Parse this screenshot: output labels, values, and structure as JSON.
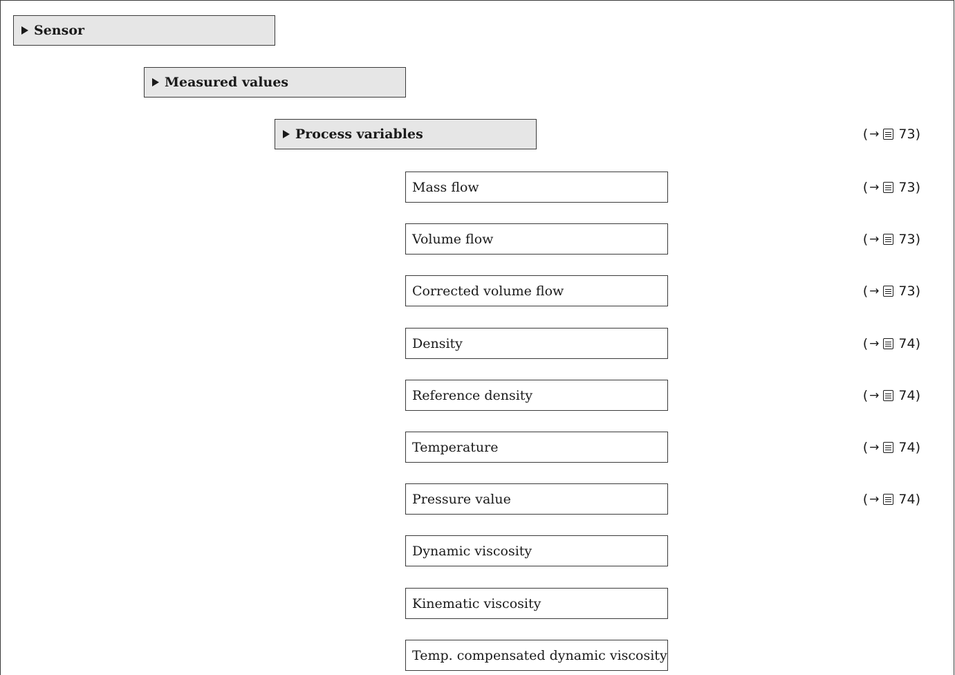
{
  "menus": {
    "sensor": "Sensor",
    "measured_values": "Measured values",
    "process_variables": "Process variables"
  },
  "process_variables_ref": {
    "page": "73"
  },
  "parameters": [
    {
      "label": "Mass flow",
      "page": "73"
    },
    {
      "label": "Volume flow",
      "page": "73"
    },
    {
      "label": "Corrected volume flow",
      "page": "73"
    },
    {
      "label": "Density",
      "page": "74"
    },
    {
      "label": "Reference density",
      "page": "74"
    },
    {
      "label": "Temperature",
      "page": "74"
    },
    {
      "label": "Pressure value",
      "page": "74"
    },
    {
      "label": "Dynamic viscosity",
      "page": ""
    },
    {
      "label": "Kinematic viscosity",
      "page": ""
    },
    {
      "label": "Temp. compensated dynamic viscosity",
      "page": ""
    }
  ],
  "ref_symbols": {
    "open": "(",
    "arrow": "→",
    "close": ")",
    "icon": "book-icon"
  }
}
